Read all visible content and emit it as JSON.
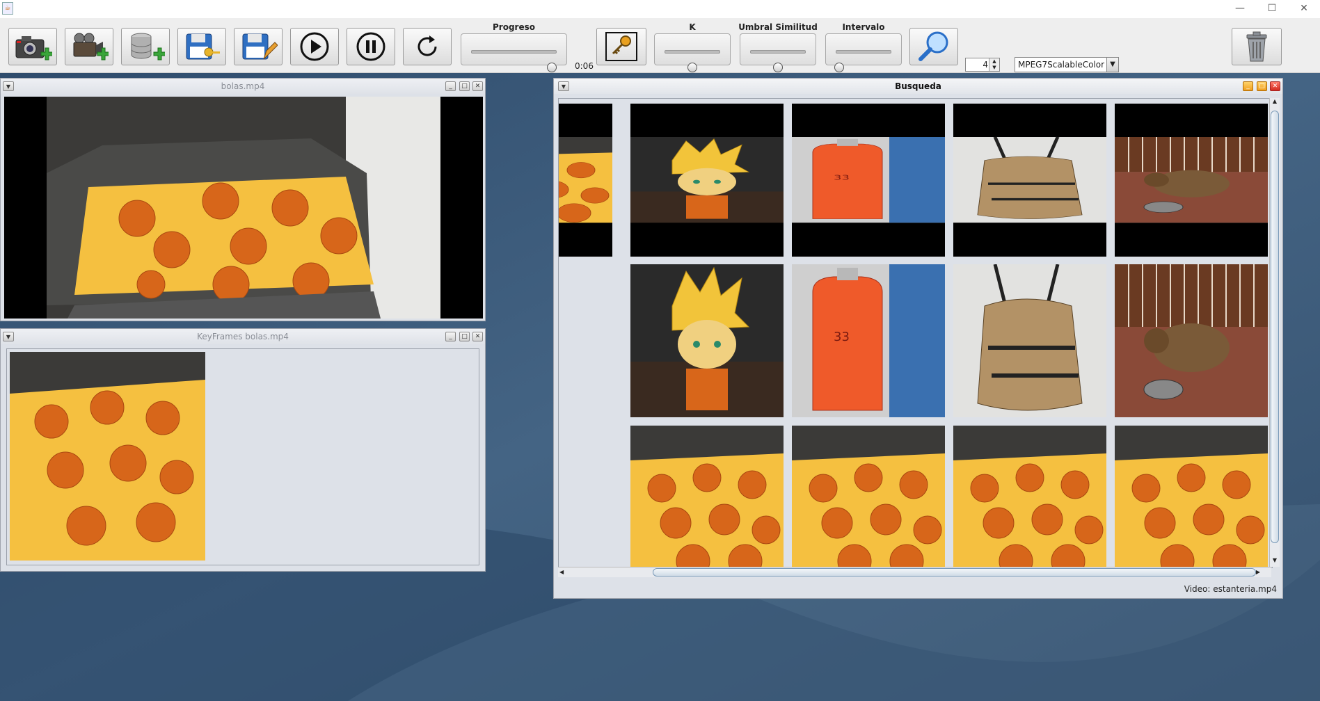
{
  "window": {
    "minimize": "—",
    "maximize": "☐",
    "close": "✕"
  },
  "toolbar": {
    "buttons": [
      {
        "name": "camera-add-button",
        "icon": "camera-plus-icon"
      },
      {
        "name": "video-camera-add-button",
        "icon": "video-camera-plus-icon"
      },
      {
        "name": "database-add-button",
        "icon": "database-plus-icon"
      },
      {
        "name": "save-key-button",
        "icon": "floppy-key-icon"
      },
      {
        "name": "save-edit-button",
        "icon": "floppy-pencil-icon"
      },
      {
        "name": "play-button",
        "icon": "play-icon"
      },
      {
        "name": "pause-button",
        "icon": "pause-icon"
      },
      {
        "name": "restart-button",
        "icon": "refresh-icon"
      }
    ],
    "progress": {
      "label": "Progreso",
      "value_fraction": 0.95
    },
    "time": "0:06",
    "keyframe_button_icon": "key-icon",
    "k": {
      "label": "K",
      "value_fraction": 0.5
    },
    "umbral": {
      "label": "Umbral Similitud",
      "value_fraction": 0.5
    },
    "intervalo": {
      "label": "Intervalo",
      "value_fraction": 0.05
    },
    "search_button_icon": "magnifier-icon",
    "spinner_value": "4",
    "descriptor_select": "MPEG7ScalableColor",
    "trash_button_icon": "trash-icon"
  },
  "video_window": {
    "title": "bolas.mp4"
  },
  "keyframes_window": {
    "title": "KeyFrames bolas.mp4"
  },
  "search_window": {
    "title": "Busqueda",
    "status": "Video: estanteria.mp4",
    "thumbnails": [
      {
        "subject": "dragon-balls"
      },
      {
        "subject": "figure"
      },
      {
        "subject": "gas-bottle"
      },
      {
        "subject": "backpack"
      },
      {
        "subject": "dog"
      },
      {
        "subject": "figure"
      },
      {
        "subject": "gas-bottle"
      },
      {
        "subject": "backpack"
      },
      {
        "subject": "dog"
      },
      {
        "subject": "dragon-balls"
      },
      {
        "subject": "dragon-balls"
      },
      {
        "subject": "dragon-balls"
      },
      {
        "subject": "dragon-balls"
      }
    ]
  }
}
